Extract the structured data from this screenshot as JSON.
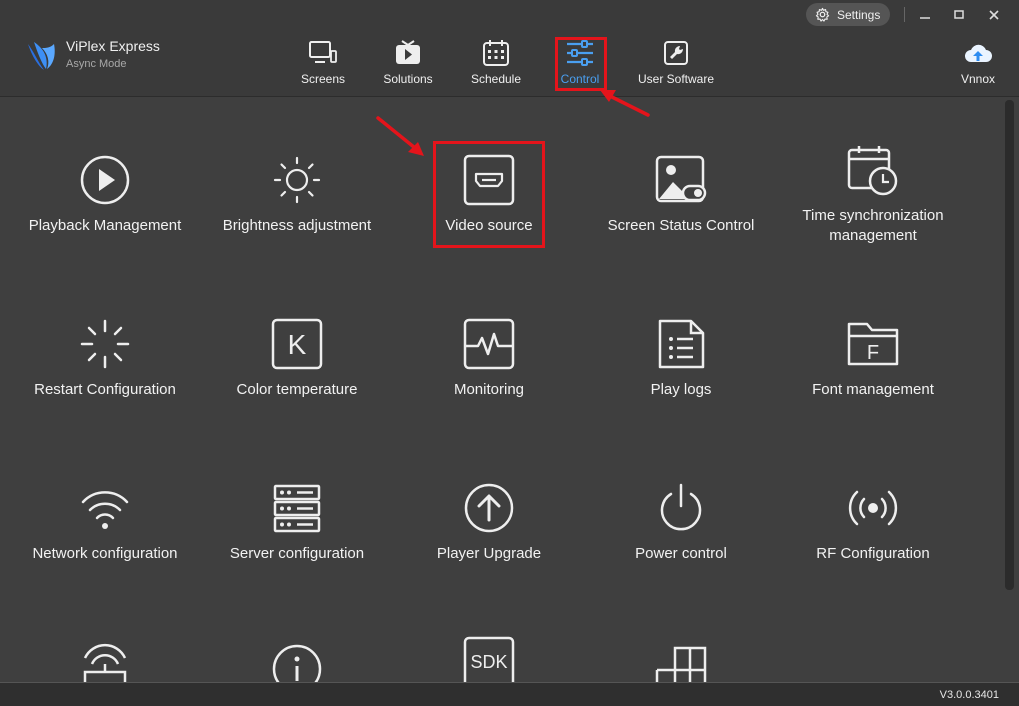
{
  "app": {
    "name": "ViPlex Express",
    "mode": "Async Mode"
  },
  "window": {
    "settings_label": "Settings"
  },
  "nav": {
    "screens": "Screens",
    "solutions": "Solutions",
    "schedule": "Schedule",
    "control": "Control",
    "user_software": "User Software",
    "vnnox": "Vnnox"
  },
  "tiles": {
    "playback": "Playback Management",
    "brightness": "Brightness adjustment",
    "video_source": "Video source",
    "screen_status": "Screen Status Control",
    "time_sync_1": "Time synchronization",
    "time_sync_2": "management",
    "restart": "Restart Configuration",
    "color_temp": "Color temperature",
    "monitoring": "Monitoring",
    "play_logs": "Play logs",
    "font_mgmt": "Font management",
    "network": "Network configuration",
    "server": "Server configuration",
    "player_upgrade": "Player Upgrade",
    "power": "Power control",
    "rf": "RF Configuration",
    "sdk_icon_text": "SDK",
    "color_temp_icon_letter": "K",
    "font_icon_letter": "F"
  },
  "status": {
    "version": "V3.0.0.3401"
  },
  "colors": {
    "accent": "#4a9ff0",
    "highlight": "#e4141b",
    "background": "#3f3f3f"
  }
}
